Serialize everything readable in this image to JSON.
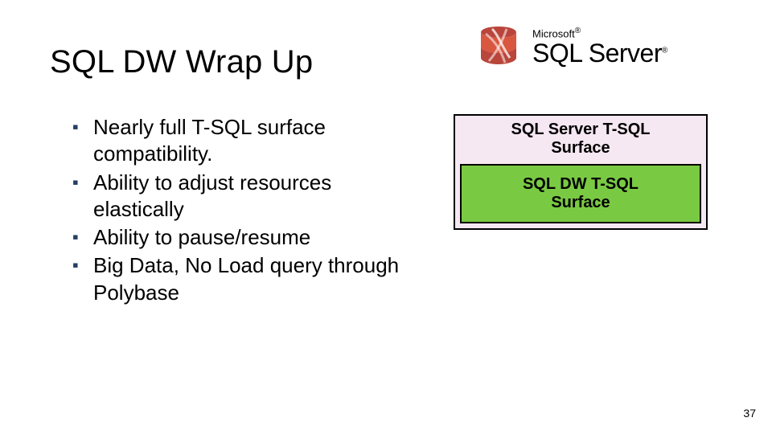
{
  "title": "SQL DW Wrap Up",
  "logo": {
    "microsoft_line": "Microsoft",
    "product_line": "SQL Server",
    "registered": "®"
  },
  "bullets": [
    "Nearly full T-SQL surface compatibility.",
    "Ability to adjust resources elastically",
    "Ability to pause/resume",
    "Big Data, No Load query through Polybase"
  ],
  "diagram": {
    "outer_label_line1": "SQL Server T-SQL",
    "outer_label_line2": "Surface",
    "inner_label_line1": "SQL DW T-SQL",
    "inner_label_line2": "Surface",
    "outer_bg": "#f6e8f2",
    "inner_bg": "#7ac943"
  },
  "page_number": "37"
}
